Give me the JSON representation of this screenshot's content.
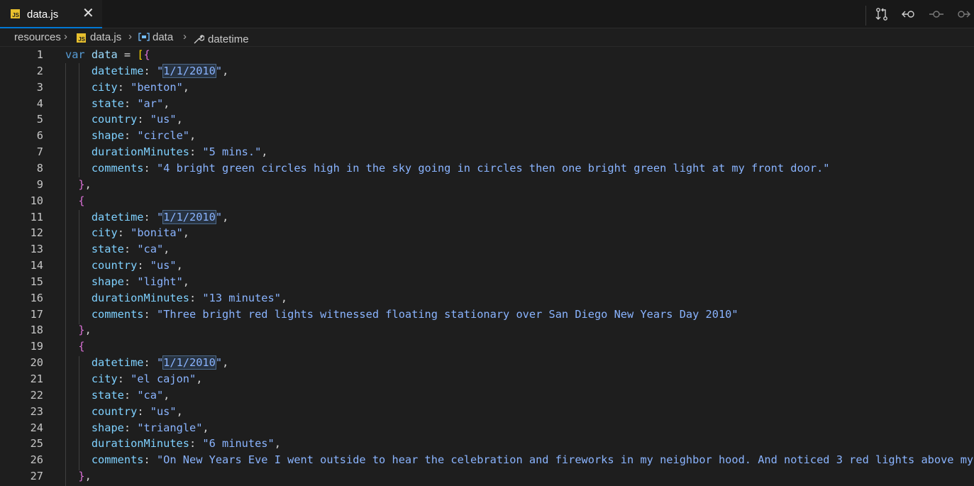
{
  "tab": {
    "filename": "data.js",
    "close_symbol": "✕",
    "icon_text": "JS"
  },
  "toolbar": {
    "icons": [
      "source-control-compare-icon",
      "go-back-icon",
      "commit-icon",
      "go-forward-icon"
    ]
  },
  "breadcrumb": {
    "folder": "resources",
    "file": "data.js",
    "symbol1": "data",
    "symbol2": "datetime"
  },
  "code": {
    "lines": [
      {
        "n": "1",
        "tokens": [
          [
            "kw",
            "var "
          ],
          [
            "var",
            "data"
          ],
          [
            "punc",
            " = "
          ],
          [
            "br1",
            "["
          ],
          [
            "br2",
            "{"
          ]
        ]
      },
      {
        "n": "2",
        "tokens": [
          [
            "prop",
            "    datetime"
          ],
          [
            "punc",
            ": "
          ],
          [
            "str",
            "\""
          ],
          [
            "hl",
            "1/1/2010"
          ],
          [
            "str",
            "\""
          ],
          [
            "punc",
            ","
          ]
        ]
      },
      {
        "n": "3",
        "tokens": [
          [
            "prop",
            "    city"
          ],
          [
            "punc",
            ": "
          ],
          [
            "str",
            "\"benton\""
          ],
          [
            "punc",
            ","
          ]
        ]
      },
      {
        "n": "4",
        "tokens": [
          [
            "prop",
            "    state"
          ],
          [
            "punc",
            ": "
          ],
          [
            "str",
            "\"ar\""
          ],
          [
            "punc",
            ","
          ]
        ]
      },
      {
        "n": "5",
        "tokens": [
          [
            "prop",
            "    country"
          ],
          [
            "punc",
            ": "
          ],
          [
            "str",
            "\"us\""
          ],
          [
            "punc",
            ","
          ]
        ]
      },
      {
        "n": "6",
        "tokens": [
          [
            "prop",
            "    shape"
          ],
          [
            "punc",
            ": "
          ],
          [
            "str",
            "\"circle\""
          ],
          [
            "punc",
            ","
          ]
        ]
      },
      {
        "n": "7",
        "tokens": [
          [
            "prop",
            "    durationMinutes"
          ],
          [
            "punc",
            ": "
          ],
          [
            "str",
            "\"5 mins.\""
          ],
          [
            "punc",
            ","
          ]
        ]
      },
      {
        "n": "8",
        "tokens": [
          [
            "prop",
            "    comments"
          ],
          [
            "punc",
            ": "
          ],
          [
            "str",
            "\"4 bright green circles high in the sky going in circles then one bright green light at my front door.\""
          ]
        ]
      },
      {
        "n": "9",
        "tokens": [
          [
            "br2",
            "  }"
          ],
          [
            "punc",
            ","
          ]
        ]
      },
      {
        "n": "10",
        "tokens": [
          [
            "br2",
            "  {"
          ]
        ]
      },
      {
        "n": "11",
        "tokens": [
          [
            "prop",
            "    datetime"
          ],
          [
            "punc",
            ": "
          ],
          [
            "str",
            "\""
          ],
          [
            "hl",
            "1/1/2010"
          ],
          [
            "str",
            "\""
          ],
          [
            "punc",
            ","
          ]
        ]
      },
      {
        "n": "12",
        "tokens": [
          [
            "prop",
            "    city"
          ],
          [
            "punc",
            ": "
          ],
          [
            "str",
            "\"bonita\""
          ],
          [
            "punc",
            ","
          ]
        ]
      },
      {
        "n": "13",
        "tokens": [
          [
            "prop",
            "    state"
          ],
          [
            "punc",
            ": "
          ],
          [
            "str",
            "\"ca\""
          ],
          [
            "punc",
            ","
          ]
        ]
      },
      {
        "n": "14",
        "tokens": [
          [
            "prop",
            "    country"
          ],
          [
            "punc",
            ": "
          ],
          [
            "str",
            "\"us\""
          ],
          [
            "punc",
            ","
          ]
        ]
      },
      {
        "n": "15",
        "tokens": [
          [
            "prop",
            "    shape"
          ],
          [
            "punc",
            ": "
          ],
          [
            "str",
            "\"light\""
          ],
          [
            "punc",
            ","
          ]
        ]
      },
      {
        "n": "16",
        "tokens": [
          [
            "prop",
            "    durationMinutes"
          ],
          [
            "punc",
            ": "
          ],
          [
            "str",
            "\"13 minutes\""
          ],
          [
            "punc",
            ","
          ]
        ]
      },
      {
        "n": "17",
        "tokens": [
          [
            "prop",
            "    comments"
          ],
          [
            "punc",
            ": "
          ],
          [
            "str",
            "\"Three bright red lights witnessed floating stationary over San Diego New Years Day 2010\""
          ]
        ]
      },
      {
        "n": "18",
        "tokens": [
          [
            "br2",
            "  }"
          ],
          [
            "punc",
            ","
          ]
        ]
      },
      {
        "n": "19",
        "tokens": [
          [
            "br2",
            "  {"
          ]
        ]
      },
      {
        "n": "20",
        "tokens": [
          [
            "prop",
            "    datetime"
          ],
          [
            "punc",
            ": "
          ],
          [
            "str",
            "\""
          ],
          [
            "hl",
            "1/1/2010"
          ],
          [
            "str",
            "\""
          ],
          [
            "punc",
            ","
          ]
        ]
      },
      {
        "n": "21",
        "tokens": [
          [
            "prop",
            "    city"
          ],
          [
            "punc",
            ": "
          ],
          [
            "str",
            "\"el cajon\""
          ],
          [
            "punc",
            ","
          ]
        ]
      },
      {
        "n": "22",
        "tokens": [
          [
            "prop",
            "    state"
          ],
          [
            "punc",
            ": "
          ],
          [
            "str",
            "\"ca\""
          ],
          [
            "punc",
            ","
          ]
        ]
      },
      {
        "n": "23",
        "tokens": [
          [
            "prop",
            "    country"
          ],
          [
            "punc",
            ": "
          ],
          [
            "str",
            "\"us\""
          ],
          [
            "punc",
            ","
          ]
        ]
      },
      {
        "n": "24",
        "tokens": [
          [
            "prop",
            "    shape"
          ],
          [
            "punc",
            ": "
          ],
          [
            "str",
            "\"triangle\""
          ],
          [
            "punc",
            ","
          ]
        ]
      },
      {
        "n": "25",
        "tokens": [
          [
            "prop",
            "    durationMinutes"
          ],
          [
            "punc",
            ": "
          ],
          [
            "str",
            "\"6 minutes\""
          ],
          [
            "punc",
            ","
          ]
        ]
      },
      {
        "n": "26",
        "tokens": [
          [
            "prop",
            "    comments"
          ],
          [
            "punc",
            ": "
          ],
          [
            "str",
            "\"On New Years Eve I went outside to hear the celebration and fireworks in my neighbor hood. And noticed 3 red lights above my"
          ]
        ]
      },
      {
        "n": "27",
        "tokens": [
          [
            "br2",
            "  }"
          ],
          [
            "punc",
            ","
          ]
        ]
      }
    ]
  },
  "colors": {
    "background": "#1e1e1e",
    "tab_accent": "#0078d4",
    "keyword": "#569cd6",
    "property": "#7fd1ff",
    "string": "#8ab4ff",
    "bracket_outer": "#ffd700",
    "bracket_inner": "#da70d6"
  }
}
